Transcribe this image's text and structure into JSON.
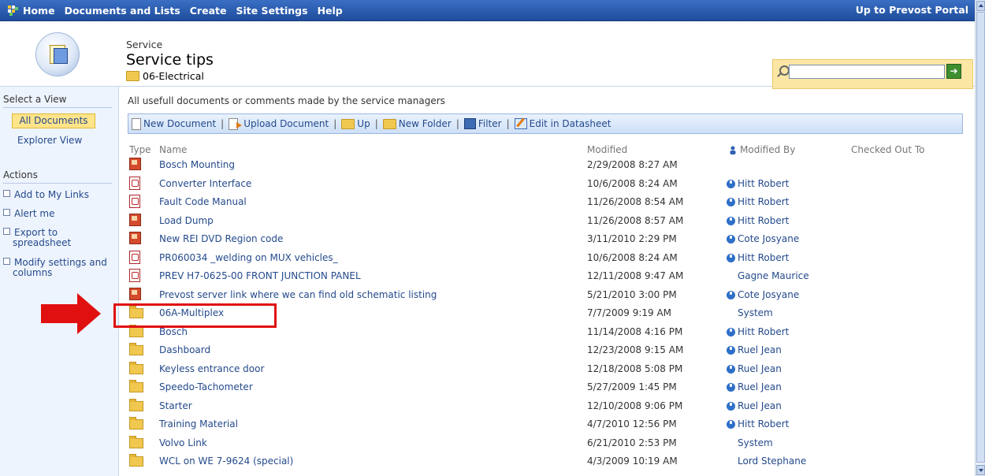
{
  "topnav": {
    "items": [
      "Home",
      "Documents and Lists",
      "Create",
      "Site Settings",
      "Help"
    ],
    "right_link": "Up to Prevost Portal"
  },
  "header": {
    "site": "Service",
    "title": "Service tips",
    "folder": "06-Electrical"
  },
  "search": {
    "value": "",
    "go_icon": "arrow-right-icon"
  },
  "leftnav": {
    "views_header": "Select a View",
    "views": [
      "All Documents",
      "Explorer View"
    ],
    "actions_header": "Actions",
    "actions": [
      "Add to My Links",
      "Alert me",
      "Export to spreadsheet",
      "Modify settings and columns"
    ]
  },
  "description": "All usefull documents or comments made by the service managers",
  "toolbar": {
    "new_document": "New Document",
    "upload_document": "Upload Document",
    "up": "Up",
    "new_folder": "New Folder",
    "filter": "Filter",
    "edit_datasheet": "Edit in Datasheet",
    "separator": "|"
  },
  "columns": {
    "type": "Type",
    "name": "Name",
    "modified": "Modified",
    "modified_by": "Modified By",
    "checked_out_to": "Checked Out To"
  },
  "rows": [
    {
      "type": "image",
      "name": "Bosch Mounting",
      "modified": "2/29/2008 8:27 AM",
      "by": "",
      "presence": "none"
    },
    {
      "type": "pdf",
      "name": "Converter Interface",
      "modified": "10/6/2008 8:24 AM",
      "by": "Hitt Robert",
      "presence": "blue"
    },
    {
      "type": "pdf",
      "name": "Fault Code Manual",
      "modified": "11/26/2008 8:54 AM",
      "by": "Hitt Robert",
      "presence": "blue"
    },
    {
      "type": "image",
      "name": "Load Dump",
      "modified": "11/26/2008 8:57 AM",
      "by": "Hitt Robert",
      "presence": "blue"
    },
    {
      "type": "image",
      "name": "New REI DVD Region code",
      "modified": "3/11/2010 2:29 PM",
      "by": "Cote Josyane",
      "presence": "blue"
    },
    {
      "type": "pdf",
      "name": "PR060034 _welding on MUX vehicles_",
      "modified": "10/6/2008 8:24 AM",
      "by": "Hitt Robert",
      "presence": "blue"
    },
    {
      "type": "pdf",
      "name": "PREV H7-0625-00 FRONT JUNCTION PANEL",
      "modified": "12/11/2008 9:47 AM",
      "by": "Gagne Maurice",
      "presence": "none"
    },
    {
      "type": "image",
      "name": "Prevost server link where we can find old schematic listing",
      "modified": "5/21/2010 3:00 PM",
      "by": "Cote Josyane",
      "presence": "blue"
    },
    {
      "type": "folder",
      "name": "06A-Multiplex",
      "modified": "7/7/2009 9:19 AM",
      "by": "System",
      "presence": "none"
    },
    {
      "type": "folder",
      "name": "Bosch",
      "modified": "11/14/2008 4:16 PM",
      "by": "Hitt Robert",
      "presence": "blue"
    },
    {
      "type": "folder",
      "name": "Dashboard",
      "modified": "12/23/2008 9:15 AM",
      "by": "Ruel Jean",
      "presence": "blue"
    },
    {
      "type": "folder",
      "name": "Keyless entrance door",
      "modified": "12/18/2008 5:08 PM",
      "by": "Ruel Jean",
      "presence": "blue"
    },
    {
      "type": "folder",
      "name": "Speedo-Tachometer",
      "modified": "5/27/2009 1:45 PM",
      "by": "Ruel Jean",
      "presence": "blue"
    },
    {
      "type": "folder",
      "name": "Starter",
      "modified": "12/10/2008 9:06 PM",
      "by": "Ruel Jean",
      "presence": "blue"
    },
    {
      "type": "folder",
      "name": "Training Material",
      "modified": "4/7/2010 12:56 PM",
      "by": "Hitt Robert",
      "presence": "blue"
    },
    {
      "type": "folder",
      "name": "Volvo Link",
      "modified": "6/21/2010 2:53 PM",
      "by": "System",
      "presence": "none"
    },
    {
      "type": "folder",
      "name": "WCL on WE 7-9624 (special)",
      "modified": "4/3/2009 10:19 AM",
      "by": "Lord Stephane",
      "presence": "none"
    }
  ],
  "annotation": {
    "highlight_row": "06A-Multiplex",
    "arrow_color": "#e01010"
  }
}
